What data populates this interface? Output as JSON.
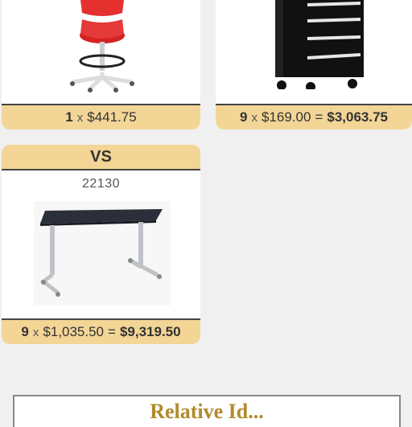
{
  "cards": [
    {
      "product": "red stool",
      "footer": {
        "qty": "1",
        "x": "x",
        "price": "$441.75"
      }
    },
    {
      "product": "black tool cabinet",
      "footer": {
        "qty": "9",
        "x": "x",
        "price": "$169.00",
        "eq": "=",
        "total": "$3,063.75"
      }
    },
    {
      "header": "VS",
      "sku": "22130",
      "product": "adjustable table",
      "footer": {
        "qty": "9",
        "x": "x",
        "price": "$1,035.50",
        "eq": "=",
        "total": "$9,319.50"
      }
    }
  ],
  "bottom_section": {
    "title": "Relative Id..."
  },
  "colors": {
    "card_band": "#f3d596",
    "background": "#f0f0f0",
    "title_gold": "#b08a2c"
  }
}
